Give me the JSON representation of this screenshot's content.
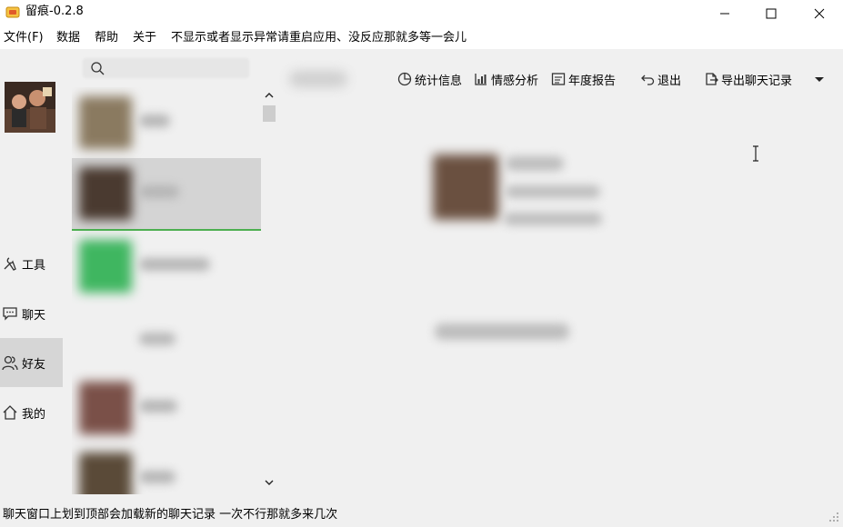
{
  "window": {
    "title": "留痕-0.2.8"
  },
  "menu": [
    "文件(F)",
    "数据",
    "帮助",
    "关于",
    "不显示或者显示异常请重启应用、没反应那就多等一会儿"
  ],
  "nav": {
    "items": [
      {
        "label": "工具",
        "icon": "tools-icon",
        "active": false
      },
      {
        "label": "聊天",
        "icon": "chat-icon",
        "active": false
      },
      {
        "label": "好友",
        "icon": "friends-icon",
        "active": true
      },
      {
        "label": "我的",
        "icon": "home-icon",
        "active": false
      }
    ]
  },
  "toolbar": {
    "stats": "统计信息",
    "sentiment": "情感分析",
    "annual_report": "年度报告",
    "exit": "退出",
    "export": "导出聊天记录"
  },
  "status": {
    "text": "聊天窗口上划到顶部会加载新的聊天记录 一次不行那就多来几次"
  },
  "colors": {
    "accent_green": "#4caf50",
    "window_bg": "#f0f0f0",
    "selected_bg": "#d4d4d4"
  }
}
